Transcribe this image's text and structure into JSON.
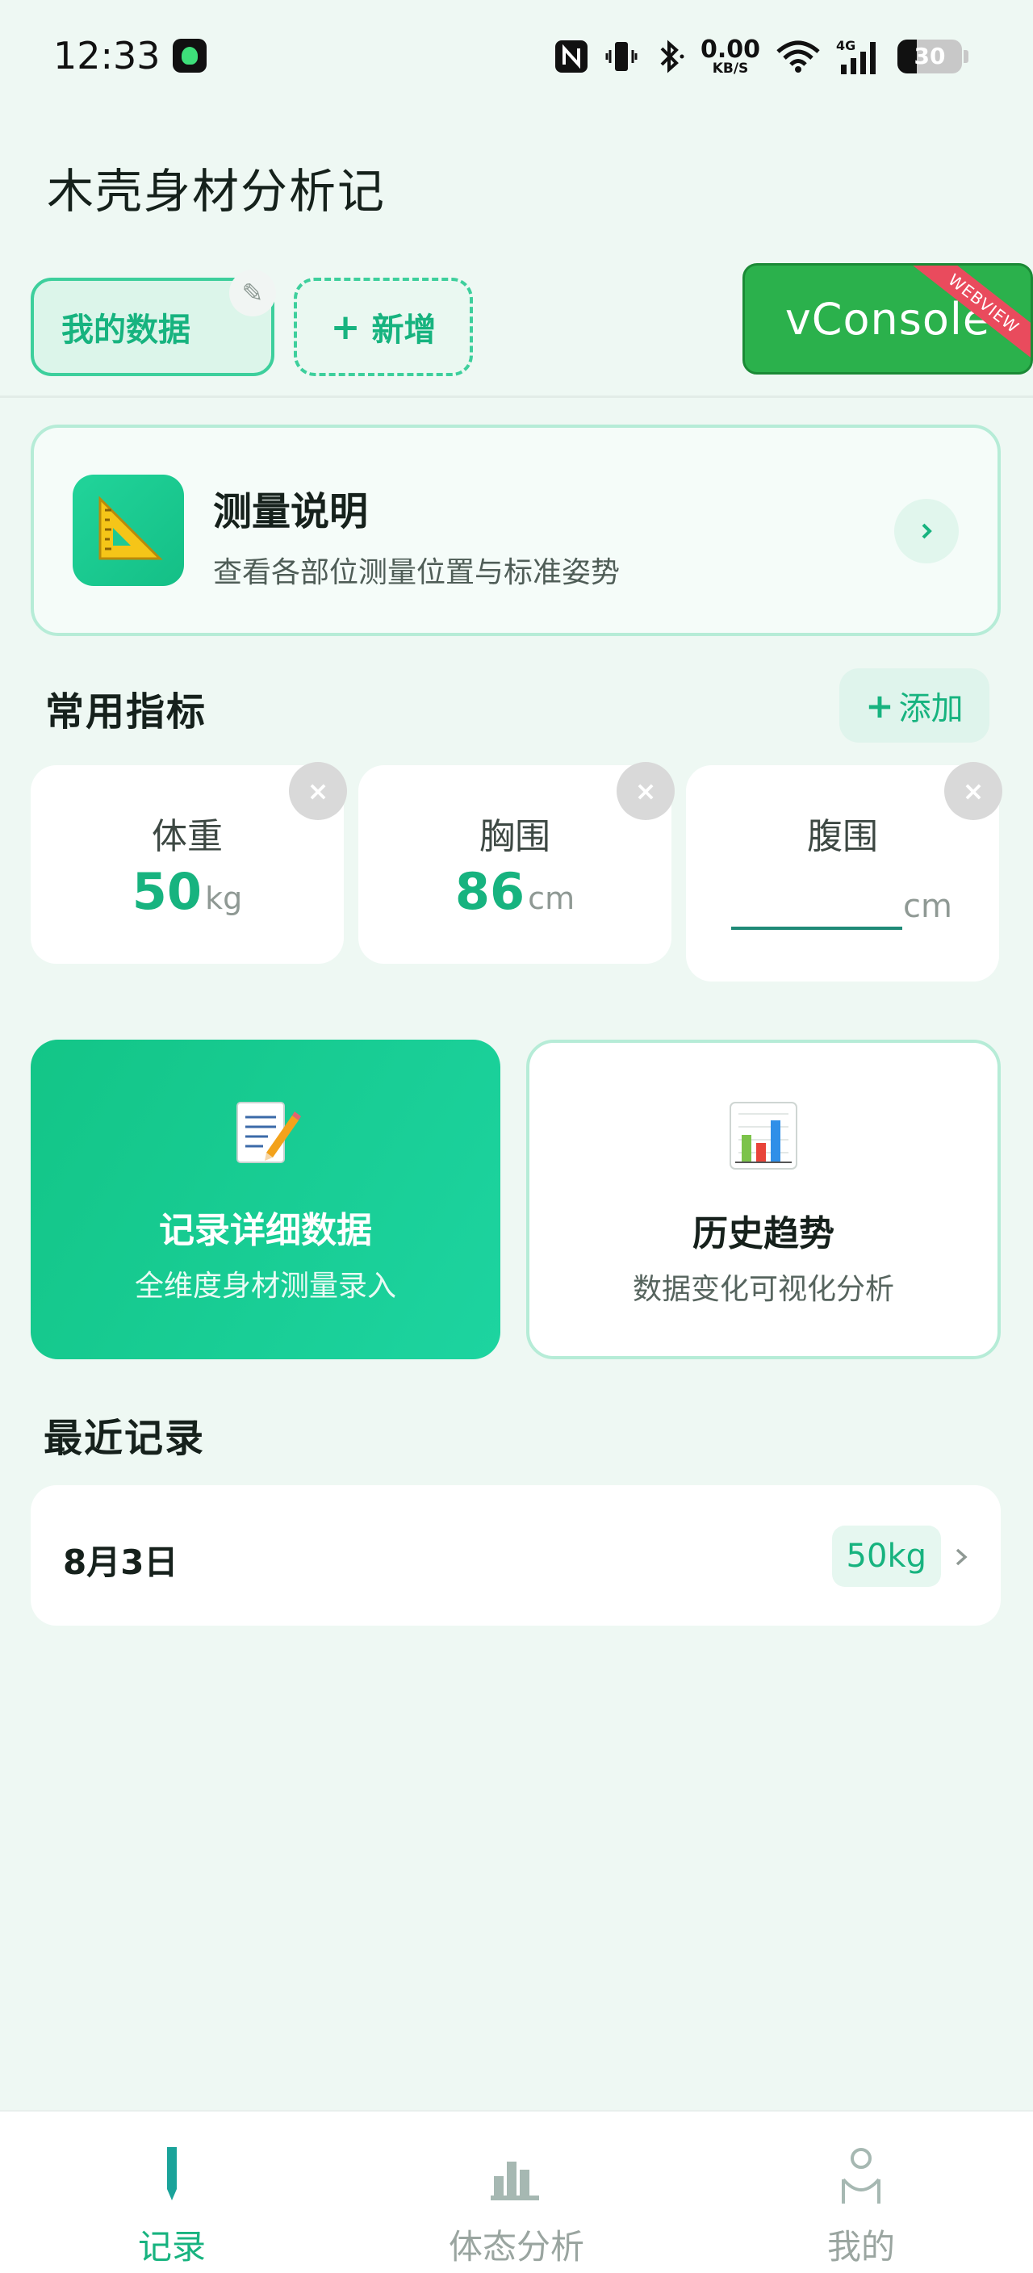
{
  "status_bar": {
    "time": "12:33",
    "net_speed_value": "0.00",
    "net_speed_unit": "KB/S",
    "network": "4G",
    "battery_level": 30,
    "battery_text": "30"
  },
  "app": {
    "title": "木壳身材分析记"
  },
  "profile_tabs": {
    "mine_label": "我的数据",
    "add_plus": "+",
    "add_label": "新增"
  },
  "vconsole": {
    "label": "vConsole",
    "ribbon": "WEBVIEW"
  },
  "guide_card": {
    "title": "测量说明",
    "subtitle": "查看各部位测量位置与标准姿势"
  },
  "common_metrics": {
    "title": "常用指标",
    "add_plus": "+",
    "add_label": "添加",
    "items": [
      {
        "name": "体重",
        "value": "50",
        "unit": "kg"
      },
      {
        "name": "胸围",
        "value": "86",
        "unit": "cm"
      },
      {
        "name": "腹围",
        "value": "",
        "unit": "cm"
      }
    ],
    "remove_glyph": "×"
  },
  "actions": {
    "record": {
      "title": "记录详细数据",
      "subtitle": "全维度身材测量录入"
    },
    "trend": {
      "title": "历史趋势",
      "subtitle": "数据变化可视化分析"
    }
  },
  "recent": {
    "title": "最近记录",
    "records": [
      {
        "date": "8月3日",
        "weight": "50kg"
      }
    ]
  },
  "bottom_nav": {
    "items": [
      {
        "label": "记录",
        "active": true
      },
      {
        "label": "体态分析",
        "active": false
      },
      {
        "label": "我的",
        "active": false
      }
    ]
  },
  "colors": {
    "accent": "#17b37f",
    "accent_light": "#dcf5ea",
    "border_light": "#b6ecd7",
    "background": "#eef8f3",
    "vconsole_green": "#2bb14c",
    "ribbon_red": "#e94b5d"
  },
  "icons": {
    "guide": "triangle-ruler-icon",
    "record_action": "memo-pencil-icon",
    "trend_action": "bar-chart-icon",
    "nav_record": "pen-icon",
    "nav_posture": "bar-chart-icon",
    "nav_mine": "person-icon"
  }
}
